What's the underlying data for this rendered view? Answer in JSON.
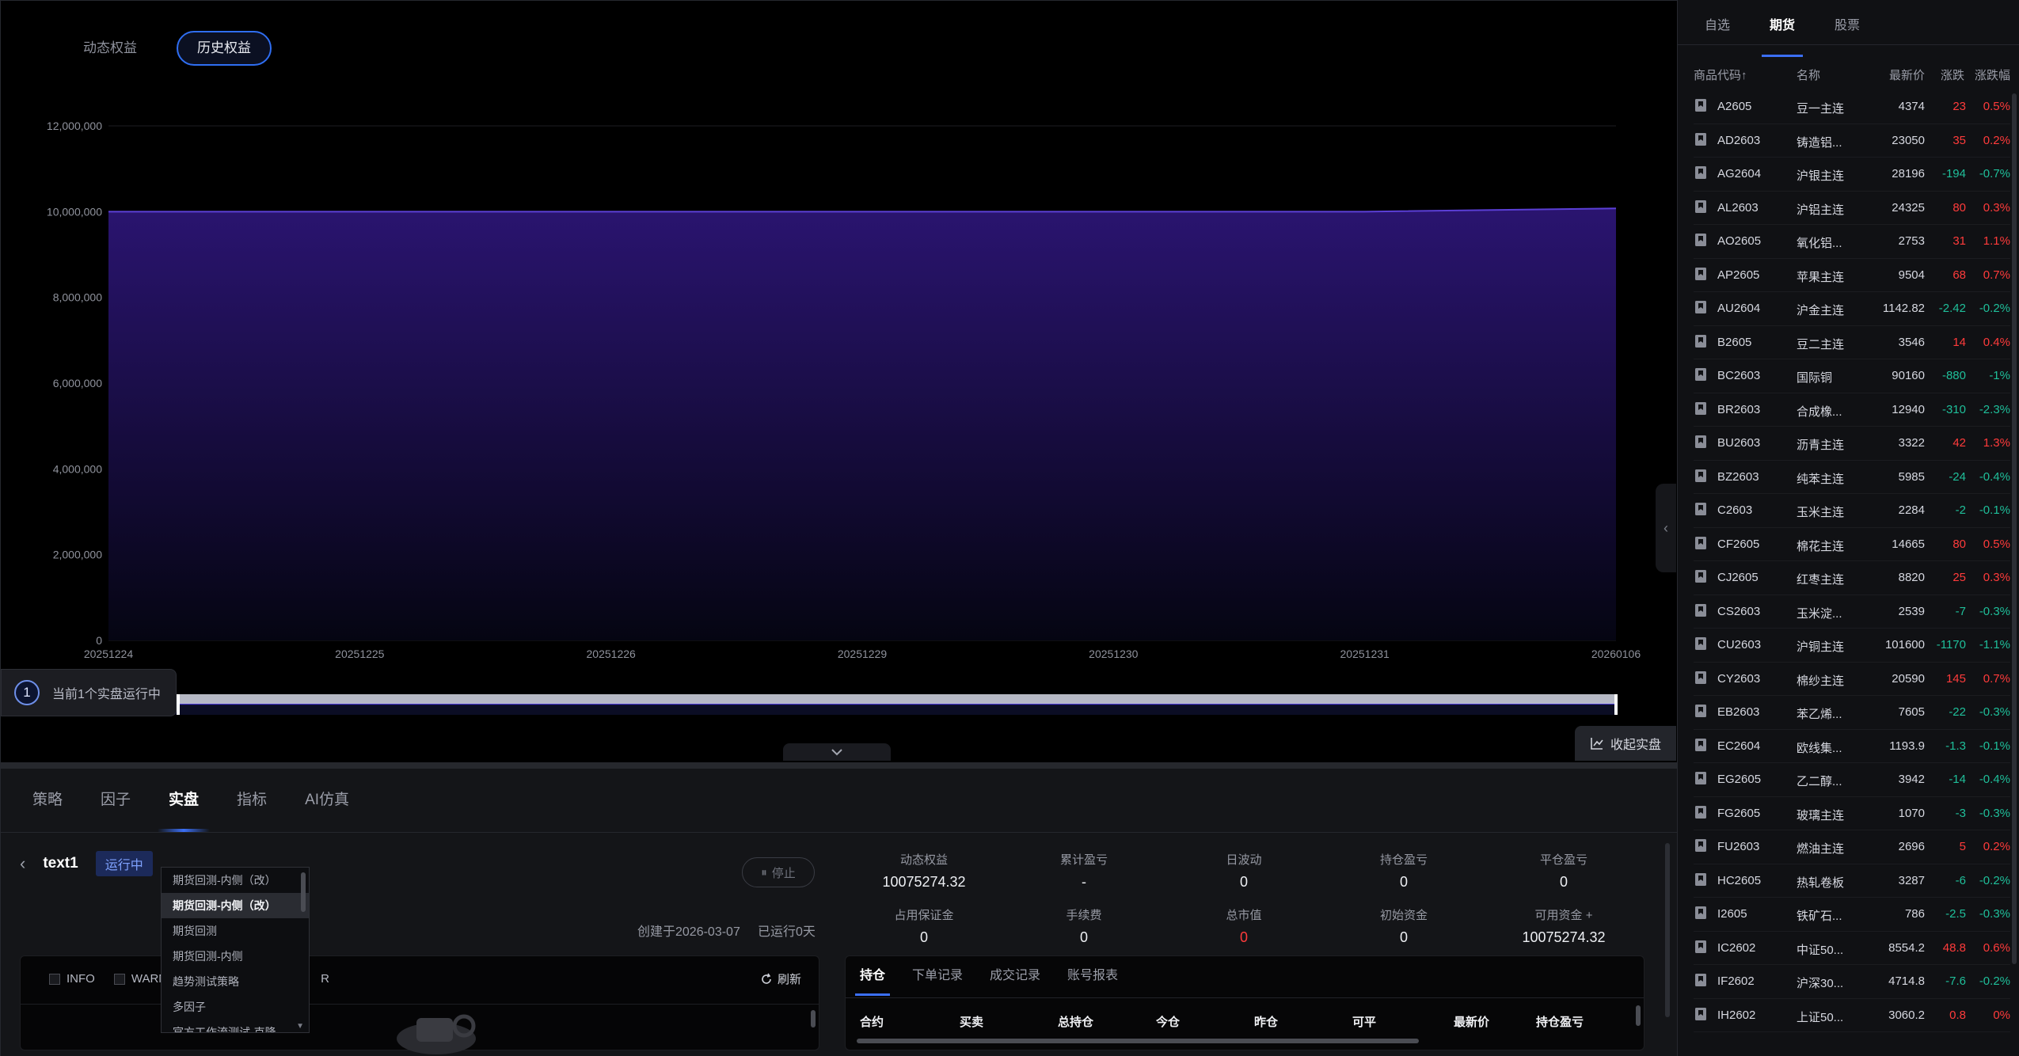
{
  "chart_toggle": {
    "dynamic_label": "动态权益",
    "history_label": "历史权益"
  },
  "chart_data": {
    "type": "area",
    "x": [
      "20251224",
      "20251225",
      "20251226",
      "20251229",
      "20251230",
      "20251231",
      "20260106"
    ],
    "series": [
      {
        "values": [
          10000000,
          10000000,
          10000000,
          10000000,
          10000000,
          10000000,
          10075274.32
        ]
      }
    ],
    "y_ticks": [
      "0",
      "2,000,000",
      "4,000,000",
      "6,000,000",
      "8,000,000",
      "10,000,000",
      "12,000,000"
    ],
    "ylim": [
      0,
      12000000
    ],
    "grid": true,
    "colors": {
      "line": "#5b3fd6",
      "fill_top": "#2a1470",
      "fill_bottom": "#050512",
      "grid": "#1b1c22",
      "axis_text": "#8f929c"
    }
  },
  "running_indicator": {
    "count": "1",
    "label": "当前1个实盘运行中"
  },
  "collect_button": {
    "label": "收起实盘"
  },
  "main_tabs": [
    "策略",
    "因子",
    "实盘",
    "指标",
    "AI仿真"
  ],
  "strategy": {
    "name": "text1",
    "status": "运行中",
    "stop_label": "停止",
    "created": "创建于2026-03-07",
    "runtime": "已运行0天",
    "dropdown_options": [
      "期货回测-内侧（改）",
      "期货回测-内侧（改）",
      "期货回测",
      "期货回测-内侧",
      "趋势测试策略",
      "多因子",
      "官方工作流测试-克隆"
    ]
  },
  "log_panel": {
    "filters": [
      "INFO",
      "WARN",
      "R"
    ],
    "refresh_label": "刷新"
  },
  "metrics": [
    {
      "label": "动态权益",
      "value": "10075274.32"
    },
    {
      "label": "累计盈亏",
      "value": "-"
    },
    {
      "label": "日波动",
      "value": "0"
    },
    {
      "label": "持仓盈亏",
      "value": "0"
    },
    {
      "label": "平仓盈亏",
      "value": "0"
    },
    {
      "label": "占用保证金",
      "value": "0"
    },
    {
      "label": "手续费",
      "value": "0"
    },
    {
      "label": "总市值",
      "value": "0"
    },
    {
      "label": "初始资金",
      "value": "0"
    },
    {
      "label": "可用资金 +",
      "value": "10075274.32"
    }
  ],
  "positions": {
    "tabs": [
      "持仓",
      "下单记录",
      "成交记录",
      "账号报表"
    ],
    "columns": [
      "合约",
      "买卖",
      "总持仓",
      "今仓",
      "昨仓",
      "可平",
      "最新价",
      "持仓盈亏"
    ]
  },
  "right_panel": {
    "tabs": [
      "自选",
      "期货",
      "股票"
    ],
    "columns": [
      "商品代码↑",
      "名称",
      "最新价",
      "涨跌",
      "涨跌幅"
    ],
    "rows": [
      {
        "code": "A2605",
        "name": "豆一主连",
        "price": "4374",
        "chg": "23",
        "pct": "0.5%",
        "dir": "up"
      },
      {
        "code": "AD2603",
        "name": "铸造铝...",
        "price": "23050",
        "chg": "35",
        "pct": "0.2%",
        "dir": "up"
      },
      {
        "code": "AG2604",
        "name": "沪银主连",
        "price": "28196",
        "chg": "-194",
        "pct": "-0.7%",
        "dir": "down"
      },
      {
        "code": "AL2603",
        "name": "沪铝主连",
        "price": "24325",
        "chg": "80",
        "pct": "0.3%",
        "dir": "up"
      },
      {
        "code": "AO2605",
        "name": "氧化铝...",
        "price": "2753",
        "chg": "31",
        "pct": "1.1%",
        "dir": "up"
      },
      {
        "code": "AP2605",
        "name": "苹果主连",
        "price": "9504",
        "chg": "68",
        "pct": "0.7%",
        "dir": "up"
      },
      {
        "code": "AU2604",
        "name": "沪金主连",
        "price": "1142.82",
        "chg": "-2.42",
        "pct": "-0.2%",
        "dir": "down"
      },
      {
        "code": "B2605",
        "name": "豆二主连",
        "price": "3546",
        "chg": "14",
        "pct": "0.4%",
        "dir": "up"
      },
      {
        "code": "BC2603",
        "name": "国际铜",
        "price": "90160",
        "chg": "-880",
        "pct": "-1%",
        "dir": "down"
      },
      {
        "code": "BR2603",
        "name": "合成橡...",
        "price": "12940",
        "chg": "-310",
        "pct": "-2.3%",
        "dir": "down"
      },
      {
        "code": "BU2603",
        "name": "沥青主连",
        "price": "3322",
        "chg": "42",
        "pct": "1.3%",
        "dir": "up"
      },
      {
        "code": "BZ2603",
        "name": "纯苯主连",
        "price": "5985",
        "chg": "-24",
        "pct": "-0.4%",
        "dir": "down"
      },
      {
        "code": "C2603",
        "name": "玉米主连",
        "price": "2284",
        "chg": "-2",
        "pct": "-0.1%",
        "dir": "down"
      },
      {
        "code": "CF2605",
        "name": "棉花主连",
        "price": "14665",
        "chg": "80",
        "pct": "0.5%",
        "dir": "up"
      },
      {
        "code": "CJ2605",
        "name": "红枣主连",
        "price": "8820",
        "chg": "25",
        "pct": "0.3%",
        "dir": "up"
      },
      {
        "code": "CS2603",
        "name": "玉米淀...",
        "price": "2539",
        "chg": "-7",
        "pct": "-0.3%",
        "dir": "down"
      },
      {
        "code": "CU2603",
        "name": "沪铜主连",
        "price": "101600",
        "chg": "-1170",
        "pct": "-1.1%",
        "dir": "down"
      },
      {
        "code": "CY2603",
        "name": "棉纱主连",
        "price": "20590",
        "chg": "145",
        "pct": "0.7%",
        "dir": "up"
      },
      {
        "code": "EB2603",
        "name": "苯乙烯...",
        "price": "7605",
        "chg": "-22",
        "pct": "-0.3%",
        "dir": "down"
      },
      {
        "code": "EC2604",
        "name": "欧线集...",
        "price": "1193.9",
        "chg": "-1.3",
        "pct": "-0.1%",
        "dir": "down"
      },
      {
        "code": "EG2605",
        "name": "乙二醇...",
        "price": "3942",
        "chg": "-14",
        "pct": "-0.4%",
        "dir": "down"
      },
      {
        "code": "FG2605",
        "name": "玻璃主连",
        "price": "1070",
        "chg": "-3",
        "pct": "-0.3%",
        "dir": "down"
      },
      {
        "code": "FU2603",
        "name": "燃油主连",
        "price": "2696",
        "chg": "5",
        "pct": "0.2%",
        "dir": "up"
      },
      {
        "code": "HC2605",
        "name": "热轧卷板",
        "price": "3287",
        "chg": "-6",
        "pct": "-0.2%",
        "dir": "down"
      },
      {
        "code": "I2605",
        "name": "铁矿石...",
        "price": "786",
        "chg": "-2.5",
        "pct": "-0.3%",
        "dir": "down"
      },
      {
        "code": "IC2602",
        "name": "中证50...",
        "price": "8554.2",
        "chg": "48.8",
        "pct": "0.6%",
        "dir": "up"
      },
      {
        "code": "IF2602",
        "name": "沪深30...",
        "price": "4714.8",
        "chg": "-7.6",
        "pct": "-0.2%",
        "dir": "down"
      },
      {
        "code": "IH2602",
        "name": "上证50...",
        "price": "3060.2",
        "chg": "0.8",
        "pct": "0%",
        "dir": "up"
      }
    ]
  }
}
